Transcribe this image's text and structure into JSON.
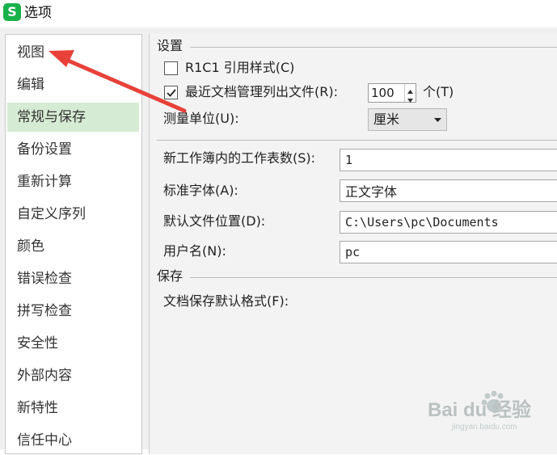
{
  "window": {
    "icon_letter": "S",
    "title": "选项"
  },
  "sidebar": {
    "items": [
      {
        "label": "视图",
        "selected": false
      },
      {
        "label": "编辑",
        "selected": false
      },
      {
        "label": "常规与保存",
        "selected": true
      },
      {
        "label": "备份设置",
        "selected": false
      },
      {
        "label": "重新计算",
        "selected": false
      },
      {
        "label": "自定义序列",
        "selected": false
      },
      {
        "label": "颜色",
        "selected": false
      },
      {
        "label": "错误检查",
        "selected": false
      },
      {
        "label": "拼写检查",
        "selected": false
      },
      {
        "label": "安全性",
        "selected": false
      },
      {
        "label": "外部内容",
        "selected": false
      },
      {
        "label": "新特性",
        "selected": false
      },
      {
        "label": "信任中心",
        "selected": false
      }
    ]
  },
  "settings": {
    "section_title": "设置",
    "r1c1": {
      "label": "R1C1 引用样式(C)",
      "checked": false
    },
    "recent_files": {
      "label": "最近文档管理列出文件(R):",
      "checked": true,
      "value": "100",
      "unit": "个(T)"
    },
    "measure_unit": {
      "label": "测量单位(U):",
      "value": "厘米"
    },
    "sheet_count": {
      "label": "新工作簿内的工作表数(S):",
      "value": "1"
    },
    "standard_font": {
      "label": "标准字体(A):",
      "value": "正文字体"
    },
    "default_location": {
      "label": "默认文件位置(D):",
      "value": "C:\\Users\\pc\\Documents"
    },
    "user_name": {
      "label": "用户名(N):",
      "value": "pc"
    }
  },
  "save": {
    "section_title": "保存",
    "default_format": {
      "label": "文档保存默认格式(F):"
    }
  },
  "colors": {
    "accent_green": "#17b24a",
    "selected_bg": "#d6ebd3",
    "annotation_red": "#e8413a"
  },
  "icons": {
    "app": "wps-spreadsheet-icon",
    "check": "check-icon",
    "spin_up": "triangle-up-icon",
    "spin_down": "triangle-down-icon",
    "dropdown": "triangle-down-icon",
    "annotation": "red-arrow-annotation"
  },
  "watermark": {
    "text": "Bai du 经验",
    "sub": "jingyan.baidu.com"
  }
}
